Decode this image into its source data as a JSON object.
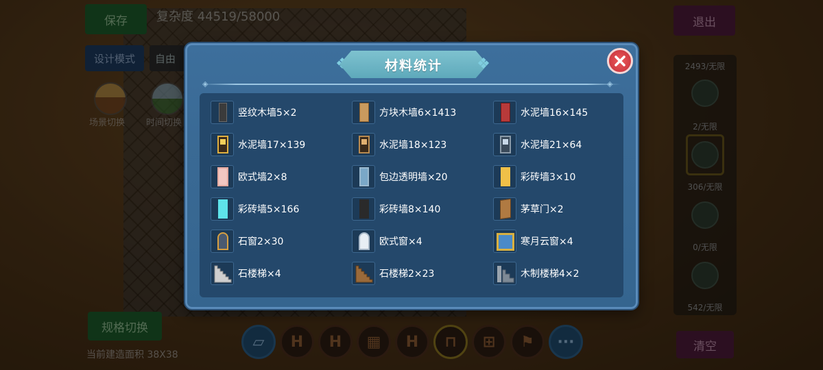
{
  "background": {
    "save_label": "保存",
    "complexity": "复杂度 44519/58000",
    "design_mode_label": "设计模式",
    "free_label": "自由",
    "scene_switch_label": "场景切换",
    "time_switch_label": "时间切换",
    "exit_label": "退出",
    "spec_switch_label": "规格切换",
    "build_area_label": "当前建造面积 38X38",
    "clear_label": "清空",
    "right_panel": [
      {
        "count": "2493/无限"
      },
      {
        "count": "2/无限"
      },
      {
        "count": "306/无限"
      },
      {
        "count": "0/无限"
      },
      {
        "count": "542/无限"
      }
    ],
    "more_label": "···"
  },
  "modal": {
    "title": "材料统计",
    "close_icon": "close-icon",
    "items": [
      {
        "label": "竖纹木墙5×2",
        "icon": "vertical-wood-wall-icon",
        "color": "#4a4a4a"
      },
      {
        "label": "方块木墙6×1413",
        "icon": "block-wood-wall-icon",
        "color": "#c99a5e"
      },
      {
        "label": "水泥墙16×145",
        "icon": "cement-wall-red-icon",
        "color": "#b83a3a"
      },
      {
        "label": "水泥墙17×139",
        "icon": "cement-wall-window-icon",
        "color": "#e0b040"
      },
      {
        "label": "水泥墙18×123",
        "icon": "cement-wall-brown-icon",
        "color": "#b88a50"
      },
      {
        "label": "水泥墙21×64",
        "icon": "cement-wall-grey-icon",
        "color": "#8a9aa8"
      },
      {
        "label": "欧式墙2×8",
        "icon": "european-wall-icon",
        "color": "#f2c7c2"
      },
      {
        "label": "包边透明墙×20",
        "icon": "transparent-wall-icon",
        "color": "#7aa8c8"
      },
      {
        "label": "彩砖墙3×10",
        "icon": "colored-brick-yellow-icon",
        "color": "#f0c048"
      },
      {
        "label": "彩砖墙5×166",
        "icon": "colored-brick-cyan-icon",
        "color": "#5ee3ea"
      },
      {
        "label": "彩砖墙8×140",
        "icon": "colored-brick-dark-icon",
        "color": "#2a2a2a"
      },
      {
        "label": "茅草门×2",
        "icon": "thatch-door-icon",
        "color": "#b07a42"
      },
      {
        "label": "石窗2×30",
        "icon": "stone-window-icon",
        "color": "#d8a040"
      },
      {
        "label": "欧式窗×4",
        "icon": "european-window-icon",
        "color": "#c8d8e8"
      },
      {
        "label": "寒月云窗×4",
        "icon": "cold-moon-window-icon",
        "color": "#d8b040"
      },
      {
        "label": "石楼梯×4",
        "icon": "stone-stairs-icon",
        "color": "#c8c8c8"
      },
      {
        "label": "石楼梯2×23",
        "icon": "stone-stairs-brown-icon",
        "color": "#9a6a3a"
      },
      {
        "label": "木制楼梯4×2",
        "icon": "wooden-stairs-icon",
        "color": "#8a8a8a"
      }
    ]
  },
  "colors": {
    "modal_bg": "#3a6a95",
    "content_bg": "#24486b",
    "title_banner": "#6db7c6",
    "close_red": "#d9404a"
  }
}
